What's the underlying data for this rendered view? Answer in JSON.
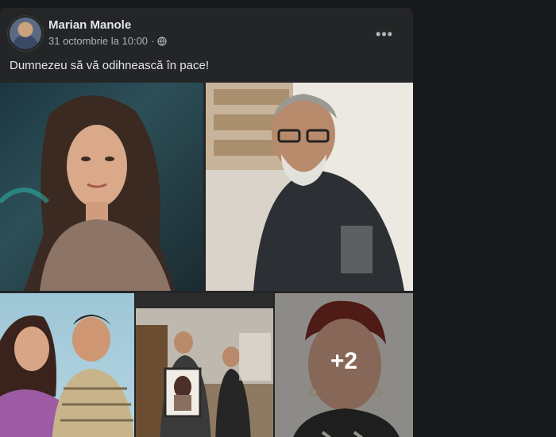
{
  "post": {
    "author": "Marian Manole",
    "timestamp": "31 octombrie la 10:00",
    "separator": "·",
    "privacy_icon": "globe-icon",
    "more_label": "•••",
    "text": "Dumnezeu să vă odihnească în pace!"
  },
  "gallery": {
    "more_count": "+2"
  },
  "colors": {
    "background": "#18191a",
    "card": "#242526",
    "primary_text": "#e4e6eb",
    "secondary_text": "#b0b3b8"
  }
}
